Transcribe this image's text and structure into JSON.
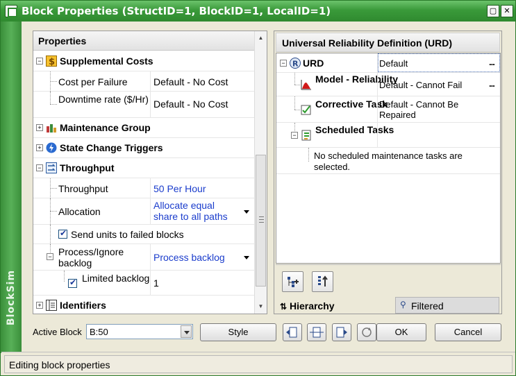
{
  "window": {
    "title": "Block Properties (StructID=1, BlockID=1, LocalID=1)",
    "brand": "BlockSim"
  },
  "properties": {
    "header": "Properties",
    "categories": {
      "supplemental": "Supplemental Costs",
      "maintenance": "Maintenance Group",
      "state_change": "State Change Triggers",
      "throughput": "Throughput",
      "identifiers": "Identifiers"
    },
    "rows": {
      "cost_per_failure": {
        "name": "Cost per Failure",
        "value": "Default - No Cost"
      },
      "downtime_rate": {
        "name": "Downtime rate ($/Hr)",
        "value": "Default - No Cost"
      },
      "throughput": {
        "name": "Throughput",
        "value": "50 Per Hour"
      },
      "allocation": {
        "name": "Allocation",
        "value": "Allocate equal share to all paths"
      },
      "send_units": {
        "name": "Send units to failed blocks"
      },
      "process_ignore": {
        "name": "Process/Ignore backlog",
        "value": "Process backlog"
      },
      "limited_backlog": {
        "name": "Limited backlog",
        "value": "1"
      }
    }
  },
  "urd": {
    "header": "Universal Reliability Definition (URD)",
    "root": {
      "name": "URD",
      "value": "Default"
    },
    "model": {
      "name": "Model - Reliability",
      "value": "Default - Cannot Fail"
    },
    "corrective": {
      "name": "Corrective Task",
      "value": "Default - Cannot Be Repaired"
    },
    "scheduled": {
      "name": "Scheduled Tasks",
      "value": ""
    },
    "scheduled_note": "No scheduled maintenance tasks are selected.",
    "ellipsis": "...",
    "tabs": {
      "hierarchy": "Hierarchy",
      "filtered": "Filtered"
    }
  },
  "footer": {
    "active_block_label": "Active Block",
    "active_block_value": "B:50",
    "style_label": "Style",
    "ok_label": "OK",
    "cancel_label": "Cancel"
  },
  "status": {
    "text": "Editing block properties"
  },
  "colors": {
    "title_green": "#3a9a3a",
    "link_blue": "#1a3ccc"
  }
}
